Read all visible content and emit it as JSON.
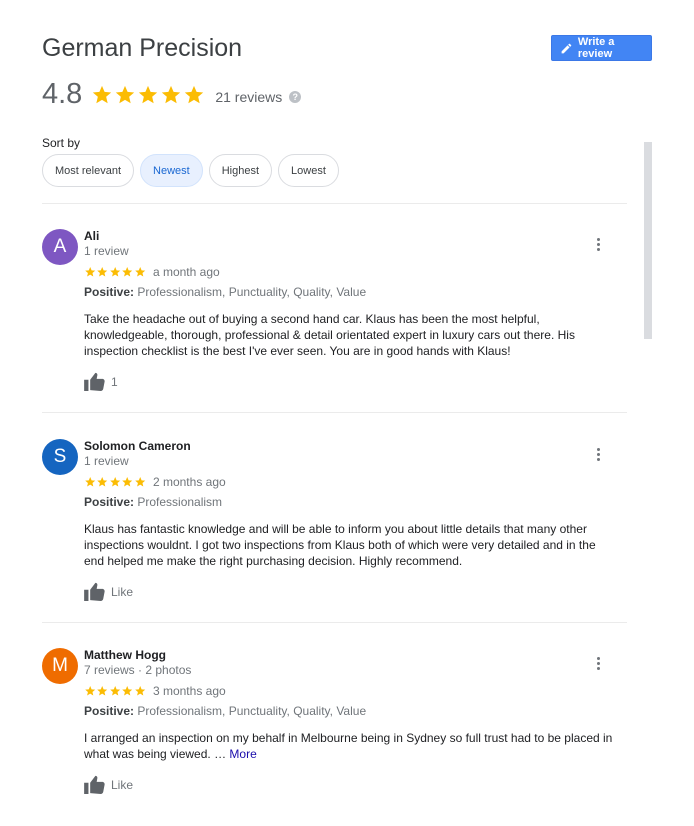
{
  "business": {
    "title": "German Precision",
    "rating": "4.8",
    "reviews_count": "21 reviews",
    "help_glyph": "?"
  },
  "write_review_label": "Write a review",
  "sort": {
    "label": "Sort by",
    "options": [
      "Most relevant",
      "Newest",
      "Highest",
      "Lowest"
    ],
    "selected": "Newest"
  },
  "colors": {
    "accent": "#4285f4",
    "star": "#fbbc04",
    "avatar_ali": "#7e57c2",
    "avatar_solomon": "#1565c0",
    "avatar_matthew": "#ef6c00"
  },
  "reviews": [
    {
      "initial": "A",
      "name": "Ali",
      "meta": "1 review",
      "stars": 5,
      "date": "a month ago",
      "positive_label": "Positive:",
      "positive": " Professionalism, Punctuality, Quality, Value",
      "text": "Take the headache out of buying a second hand car. Klaus has been the most helpful, knowledgeable, thorough, professional & detail orientated expert in luxury cars out there. His inspection checklist is the best I've ever seen.  You are in good hands with Klaus!",
      "likes": "1"
    },
    {
      "initial": "S",
      "name": "Solomon Cameron",
      "meta": "1 review",
      "stars": 5,
      "date": "2 months ago",
      "positive_label": "Positive:",
      "positive": " Professionalism",
      "text": "Klaus has fantastic knowledge and will be able to inform you about little details that many other inspections wouldnt. I got two inspections from Klaus both of which were very detailed and in the end helped me make the right purchasing decision. Highly recommend.",
      "likes": "Like"
    },
    {
      "initial": "M",
      "name": "Matthew Hogg",
      "meta": "7 reviews · 2 photos",
      "stars": 5,
      "date": "3 months ago",
      "positive_label": "Positive:",
      "positive": " Professionalism, Punctuality, Quality, Value",
      "text": "I arranged an inspection on my behalf in Melbourne being in Sydney so full trust had to be placed in what was being viewed. ",
      "ellipsis": "…",
      "more": "More",
      "likes": "Like"
    }
  ]
}
